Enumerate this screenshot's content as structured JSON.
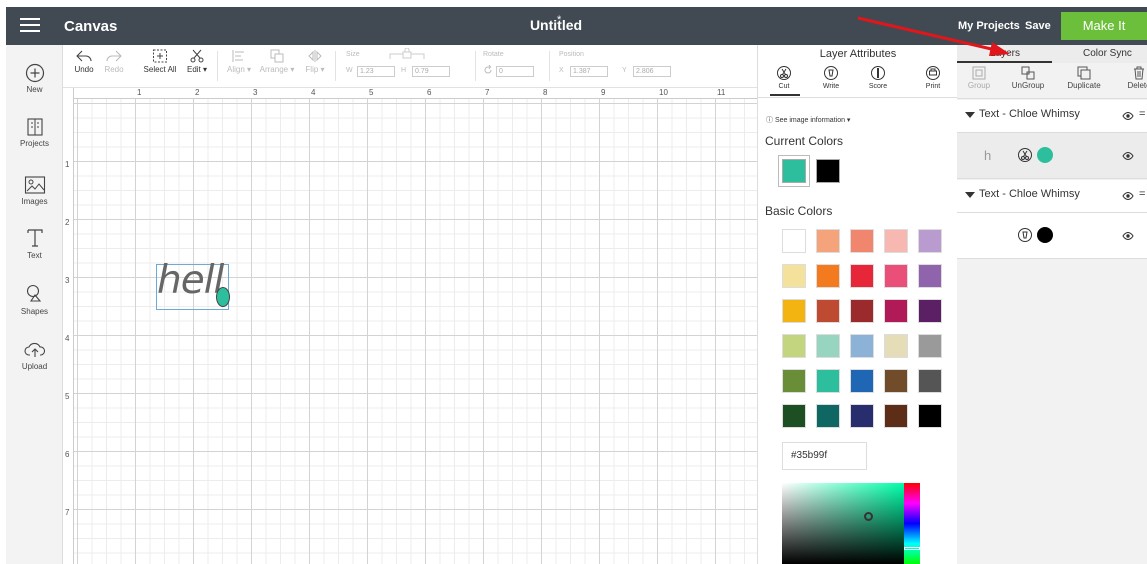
{
  "header": {
    "app_name": "Canvas",
    "doc_title": "Untitled",
    "dirty_mark": "*",
    "my_projects": "My Projects",
    "save": "Save",
    "make_it": "Make It"
  },
  "sidebar": {
    "items": [
      {
        "label": "New",
        "icon": "plus-circle-icon"
      },
      {
        "label": "Projects",
        "icon": "projects-icon"
      },
      {
        "label": "Images",
        "icon": "image-icon"
      },
      {
        "label": "Text",
        "icon": "text-icon"
      },
      {
        "label": "Shapes",
        "icon": "shapes-icon"
      },
      {
        "label": "Upload",
        "icon": "upload-cloud-icon"
      }
    ]
  },
  "toolbar": {
    "undo": "Undo",
    "redo": "Redo",
    "select_all": "Select All",
    "edit": "Edit ▾",
    "align": "Align ▾",
    "arrange": "Arrange ▾",
    "flip": "Flip ▾",
    "size_label": "Size",
    "w_label": "W",
    "w_value": "1.23",
    "h_label": "H",
    "h_value": "0.79",
    "rotate_label": "Rotate",
    "rotate_value": "0",
    "position_label": "Position",
    "x_label": "X",
    "x_value": "1.387",
    "y_label": "Y",
    "y_value": "2.806"
  },
  "ruler": {
    "top": [
      "1",
      "2",
      "3",
      "4",
      "5",
      "6",
      "7",
      "8",
      "9",
      "10",
      "11"
    ],
    "left": [
      "1",
      "2",
      "3",
      "4",
      "5",
      "6",
      "7"
    ]
  },
  "canvas": {
    "text": "hell"
  },
  "attributes": {
    "title": "Layer Attributes",
    "tools": [
      "Cut",
      "Write",
      "Score",
      "Print"
    ],
    "info": "ⓘ See image information ▾",
    "current_colors_label": "Current Colors",
    "current_colors": [
      "#2dbe9e",
      "#000000"
    ],
    "basic_colors_label": "Basic Colors",
    "basic_colors": [
      [
        "#ffffff",
        "#f4a37a",
        "#f1866e",
        "#f6b8b0",
        "#b99bd0"
      ],
      [
        "#f3e19c",
        "#f37a1f",
        "#e8263a",
        "#ea4f79",
        "#8f64ac"
      ],
      [
        "#f3b412",
        "#bf4a32",
        "#9a2a2c",
        "#b01b57",
        "#5b1f63"
      ],
      [
        "#c3d67f",
        "#98d5c0",
        "#8cb3d7",
        "#e5ddb8",
        "#9a9a9a"
      ],
      [
        "#6a8e37",
        "#2dbe9e",
        "#1f66b5",
        "#714c2b",
        "#555555"
      ],
      [
        "#1e4f23",
        "#0e6763",
        "#282d6e",
        "#5d2d18",
        "#000000"
      ]
    ],
    "hex_value": "#35b99f"
  },
  "layers": {
    "tabs": [
      "Layers",
      "Color Sync"
    ],
    "actions": [
      {
        "label": "Group",
        "enabled": false
      },
      {
        "label": "UnGroup",
        "enabled": true
      },
      {
        "label": "Duplicate",
        "enabled": true
      },
      {
        "label": "Delete",
        "enabled": true
      }
    ],
    "groups": [
      {
        "name": "Text - Chloe Whimsy",
        "child_glyph": "h",
        "child_color": "#2dbe9e"
      },
      {
        "name": "Text - Chloe Whimsy",
        "child_glyph": "",
        "child_color": "#000000"
      }
    ]
  }
}
